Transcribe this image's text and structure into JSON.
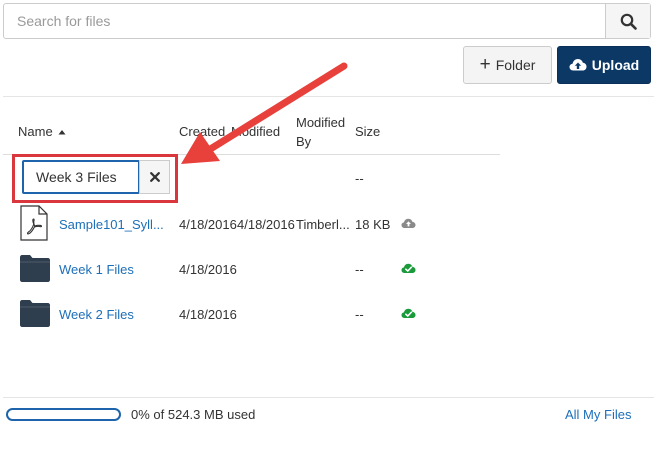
{
  "search": {
    "placeholder": "Search for files"
  },
  "toolbar": {
    "folder_label": "Folder",
    "upload_label": "Upload"
  },
  "columns": {
    "name": "Name",
    "created": "Created",
    "modified": "Modified",
    "modified_by_line1": "Modified",
    "modified_by_line2": "By",
    "size": "Size"
  },
  "new_folder": {
    "value": "Week 3 Files",
    "size": "--"
  },
  "rows": [
    {
      "name": "Sample101_Syll...",
      "created": "4/18/2016",
      "modified": "4/18/2016",
      "modified_by": "Timberl...",
      "size": "18 KB",
      "status": "cloud-icon"
    },
    {
      "name": "Week 1 Files",
      "created": "4/18/2016",
      "modified": "",
      "modified_by": "",
      "size": "--",
      "status": "cloud-check-icon"
    },
    {
      "name": "Week 2 Files",
      "created": "4/18/2016",
      "modified": "",
      "modified_by": "",
      "size": "--",
      "status": "cloud-check-icon"
    }
  ],
  "footer": {
    "usage": "0% of 524.3 MB used",
    "usage_fraction": 0,
    "all_files": "All My Files"
  },
  "colors": {
    "brand": "#0c3866",
    "link": "#1d6fb8",
    "highlight": "#d9363e",
    "check": "#1a9a3a"
  }
}
